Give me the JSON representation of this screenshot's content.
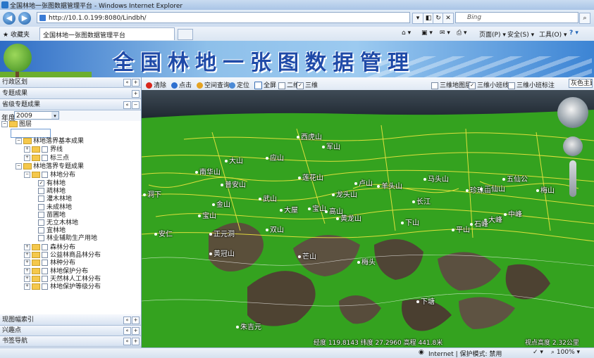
{
  "window": {
    "title": "全国林地一张图数据管理平台 - Windows Internet Explorer"
  },
  "browser": {
    "url": "http://10.1.0.199:8080/Lindbh/",
    "search_placeholder": "Bing",
    "favorites_label": "收藏夹",
    "tab_title": "全国林地一张图数据管理平台",
    "commands": {
      "page": "页面(P)",
      "safety": "安全(S)",
      "tools": "工具(O)",
      "help": "?"
    },
    "status": {
      "zone": "Internet | 保护模式: 禁用",
      "zoom": "100%"
    }
  },
  "banner": {
    "title": "全国林地一张图数据管理"
  },
  "left_panel": {
    "sections": {
      "admin_region": "行政区划",
      "thematic_results": "专题成果",
      "provincial_results": "省级专题成果",
      "map_index": "现图幅索引",
      "hotspots": "兴趣点",
      "bookmarks": "书签导航"
    },
    "year_label": "年度",
    "year_value": "2009",
    "tree": {
      "root": "图层",
      "base_group": "林地落界基本成果",
      "boundary": "界线",
      "tripoint": "标三点",
      "thematic_group": "林地落界专题成果",
      "forest_dist": "林地分布",
      "items": [
        {
          "label": "有林地",
          "checked": true
        },
        {
          "label": "疏林地",
          "checked": false
        },
        {
          "label": "灌木林地",
          "checked": false
        },
        {
          "label": "未成林地",
          "checked": false
        },
        {
          "label": "苗圃地",
          "checked": false
        },
        {
          "label": "无立木林地",
          "checked": false
        },
        {
          "label": "宜林地",
          "checked": false
        },
        {
          "label": "林业辅助生产用地",
          "checked": false
        }
      ],
      "more_groups": [
        "森林分布",
        "公益林商品林分布",
        "林种分布",
        "林地保护分布",
        "天然林人工林分布",
        "林地保护等级分布"
      ]
    }
  },
  "toolbar": {
    "clear": "清除",
    "point": "点击",
    "spatial_query": "空间查询",
    "locate": "定位",
    "fullscreen": "全屏",
    "mode_2d": "二维",
    "mode_3d": "三维",
    "opt_3d_layers": "三维地图层",
    "opt_3d_small_class": "三维小班线",
    "opt_3d_small_label": "三维小班标注",
    "theme_select": "灰色主题",
    "mode_2d_checked": false,
    "mode_3d_checked": true,
    "opt_3d_layers_checked": false,
    "opt_3d_small_class_checked": true,
    "opt_3d_small_label_checked": false
  },
  "map": {
    "places": [
      "山",
      "西虎山",
      "大山",
      "应山",
      "军山",
      "五仙公",
      "南华山",
      "卢山",
      "羊头山",
      "莲花山",
      "普安山",
      "马头山",
      "珍珠山",
      "武山",
      "梅山",
      "长江",
      "安仁",
      "宝山",
      "金山",
      "龙头山",
      "大峰",
      "石峰",
      "中峰",
      "黄龙山",
      "大屋",
      "黄冠山",
      "三仙山",
      "高山",
      "平山",
      "下山",
      "宝山",
      "山",
      "正元洞",
      "黄头山",
      "芒山",
      "梅头",
      "双山",
      "下塘",
      "洞下",
      "朱吉元"
    ],
    "readout_left": "经度 119.8143  纬度 27.2960  高程 441.8米",
    "readout_right": "视点高度 2.32公里",
    "colors": {
      "vegetation": "#2e9c1c",
      "terrain": "#5a4f3a",
      "boundary_lines": "#f0e640"
    }
  }
}
